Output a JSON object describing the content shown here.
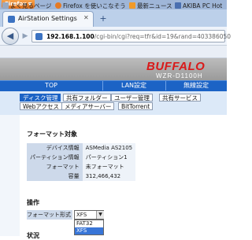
{
  "browser": {
    "menu_button": "Firefox",
    "tab_title": "AirStation Settings",
    "url_host": "192.168.1.100",
    "url_rest": "/cgi-bin/cgi?req=tfr&id=19&rand=403386050",
    "bookmarks": [
      "よく見るページ",
      "Firefox を使いこなそう",
      "最新ニュース",
      "AKIBA PC Hot"
    ]
  },
  "router": {
    "brand": "BUFFALO",
    "model": "WZR-D1100H",
    "main_tabs": [
      "TOP",
      "LAN設定",
      "無線設定"
    ],
    "sub_tabs_row1": [
      "ディスク管理",
      "共有フォルダー",
      "ユーザー管理",
      "共有サービス"
    ],
    "sub_tabs_row2": [
      "Webアクセス",
      "メディアサーバー",
      "BitTorrent"
    ],
    "format_section_title": "フォーマット対象",
    "info": [
      {
        "key": "デバイス情報",
        "value": "ASMedia AS2105"
      },
      {
        "key": "パーティション情報",
        "value": "パーティション1"
      },
      {
        "key": "フォーマット",
        "value": "未フォーマット"
      },
      {
        "key": "容量",
        "value": "312,466,432"
      }
    ],
    "operation_title": "操作",
    "format_type_label": "フォーマット形式",
    "format_selected": "XFS",
    "format_options": [
      "FAT32",
      "XFS"
    ],
    "status_title": "状況"
  },
  "colors": {
    "nav_blue": "#1c63c5",
    "brand_red": "#d91a1a",
    "firefox_orange": "#e0711d"
  }
}
